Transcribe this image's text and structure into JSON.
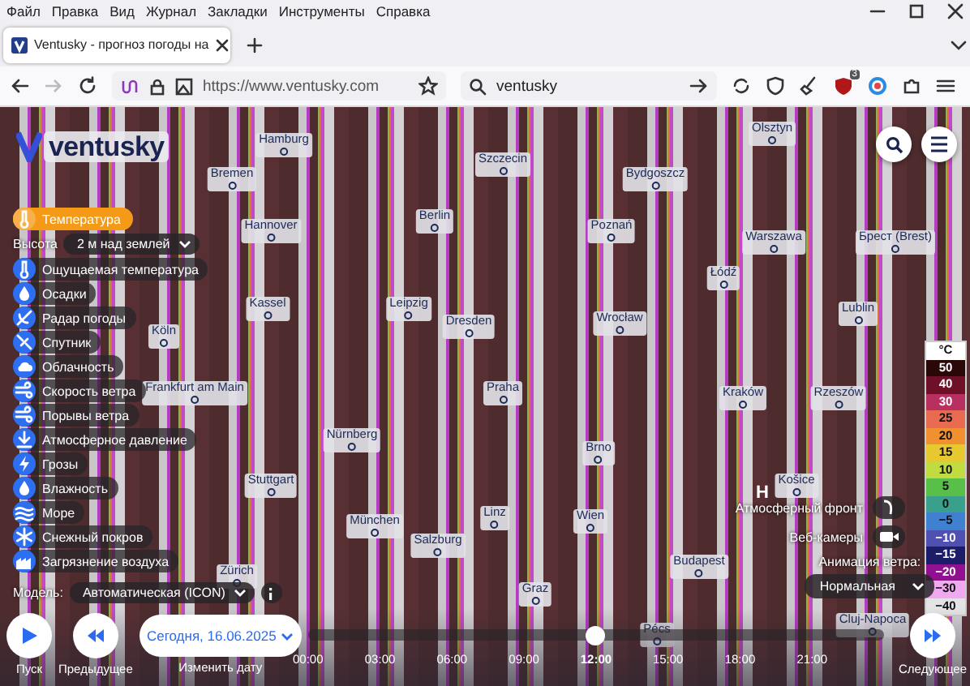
{
  "menu_bar": {
    "items": [
      "Файл",
      "Правка",
      "Вид",
      "Журнал",
      "Закладки",
      "Инструменты",
      "Справка"
    ]
  },
  "tabs": [
    {
      "title": "Ventusky - прогноз погоды на",
      "selected": true
    }
  ],
  "nav": {
    "forward_disabled": true,
    "url": "https://www.ventusky.com",
    "search_value": "ventusky",
    "badge": "3"
  },
  "app": {
    "logo": "ventusky",
    "layers": [
      {
        "label": "Температура",
        "selected": true
      },
      {
        "label": "Ощущаемая температура",
        "selected": false
      },
      {
        "label": "Осадки",
        "selected": false
      },
      {
        "label": "Радар погоды",
        "selected": false
      },
      {
        "label": "Спутник",
        "selected": false
      },
      {
        "label": "Облачность",
        "selected": false
      },
      {
        "label": "Скорость ветра",
        "selected": false
      },
      {
        "label": "Порывы ветра",
        "selected": false
      },
      {
        "label": "Атмосферное давление",
        "selected": false
      },
      {
        "label": "Грозы",
        "selected": false
      },
      {
        "label": "Влажность",
        "selected": false
      },
      {
        "label": "Море",
        "selected": false
      },
      {
        "label": "Снежный покров",
        "selected": false
      },
      {
        "label": "Загрязнение воздуха",
        "selected": false
      }
    ],
    "height_label": "Высота",
    "height_value": "2 м над землей",
    "model_label": "Модель:",
    "model_value": "Автоматическая (ICON)"
  },
  "map": {
    "cities": [
      "Olsztyn",
      "Hamburg",
      "Szczecin",
      "Bremen",
      "Bydgoszcz",
      "Berlin",
      "Hannover",
      "Poznań",
      "Warszawa",
      "Брест (Brest)",
      "Łódź",
      "Kassel",
      "Leipzig",
      "Lublin",
      "Wrocław",
      "Dresden",
      "Köln",
      "Frankfurt am Main",
      "Praha",
      "Kraków",
      "Rzeszów",
      "Nürnberg",
      "Brno",
      "Stuttgart",
      "Košice",
      "Linz",
      "Wien",
      "München",
      "Salzburg",
      "Budapest",
      "Zürich",
      "Graz",
      "Cluj-Napoca",
      "Pécs"
    ],
    "pressure_marks": [
      "H"
    ]
  },
  "legend": {
    "unit": "°C",
    "steps": [
      {
        "label": "50",
        "color": "#2a0808"
      },
      {
        "label": "40",
        "color": "#6e1028"
      },
      {
        "label": "30",
        "color": "#b83060"
      },
      {
        "label": "25",
        "color": "#e86a50"
      },
      {
        "label": "20",
        "color": "#f09030"
      },
      {
        "label": "15",
        "color": "#e8c830"
      },
      {
        "label": "10",
        "color": "#c0dc40"
      },
      {
        "label": "5",
        "color": "#58c048"
      },
      {
        "label": "0",
        "color": "#38a08c"
      },
      {
        "label": "−5",
        "color": "#4080d0"
      },
      {
        "label": "−10",
        "color": "#5050b0"
      },
      {
        "label": "−15",
        "color": "#1c1c68"
      },
      {
        "label": "−20",
        "color": "#901090"
      },
      {
        "label": "−30",
        "color": "#f0a8f0"
      },
      {
        "label": "−40",
        "color": "#e4e4e4"
      }
    ]
  },
  "overlay": {
    "front_label": "Атмосферный фронт",
    "webcams_label": "Веб-камеры",
    "wind_label": "Анимация ветра:",
    "wind_value": "Нормальная"
  },
  "timeline": {
    "play": "Пуск",
    "previous": "Предыдущее",
    "date": "Сегодня, 16.06.2025",
    "change_date": "Изменить дату",
    "next": "Следующее",
    "level": 0.5,
    "times": [
      {
        "label": "00:00",
        "selected": false
      },
      {
        "label": "03:00",
        "selected": false
      },
      {
        "label": "06:00",
        "selected": false
      },
      {
        "label": "09:00",
        "selected": false
      },
      {
        "label": "12:00",
        "selected": true
      },
      {
        "label": "15:00",
        "selected": false
      },
      {
        "label": "18:00",
        "selected": false
      },
      {
        "label": "21:00",
        "selected": false
      }
    ]
  }
}
